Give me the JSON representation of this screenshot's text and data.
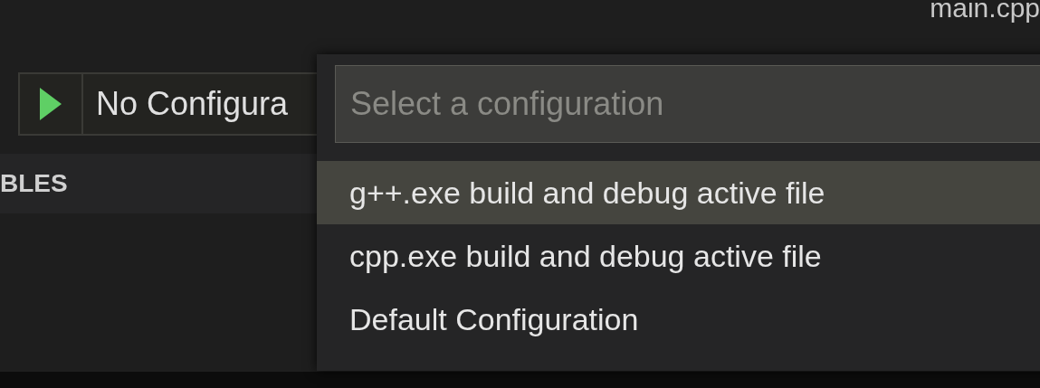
{
  "title_bar": {
    "title": "main.cpp"
  },
  "debug_toolbar": {
    "configuration": "No Configura"
  },
  "sidebar": {
    "section": "BLES"
  },
  "quick_pick": {
    "placeholder": "Select a configuration",
    "items": [
      {
        "label": "g++.exe build and debug active file",
        "selected": true
      },
      {
        "label": "cpp.exe build and debug active file",
        "selected": false
      },
      {
        "label": "Default Configuration",
        "selected": false
      }
    ]
  }
}
